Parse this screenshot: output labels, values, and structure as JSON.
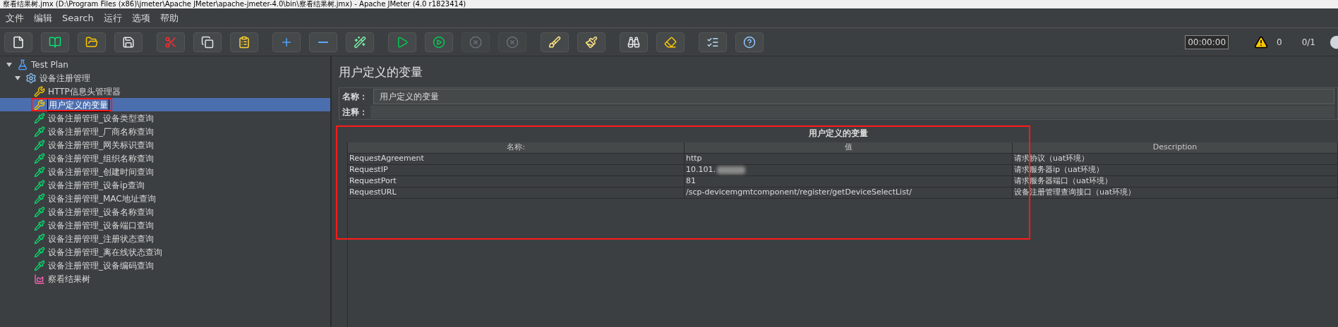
{
  "window": {
    "title": "察看结果树.jmx (D:\\Program Files (x86)\\jmeter\\Apache JMeter\\apache-jmeter-4.0\\bin\\察看结果树.jmx) - Apache JMeter (4.0 r1823414)"
  },
  "menu": [
    {
      "label": "文件"
    },
    {
      "label": "编辑"
    },
    {
      "label": "Search"
    },
    {
      "label": "运行"
    },
    {
      "label": "选项"
    },
    {
      "label": "帮助"
    }
  ],
  "toolbar": [
    [
      {
        "kind": "new",
        "disabled": false
      },
      {
        "kind": "templates",
        "disabled": false
      },
      {
        "kind": "open",
        "disabled": false
      },
      {
        "kind": "save",
        "disabled": false
      }
    ],
    [
      {
        "kind": "cut",
        "disabled": false
      },
      {
        "kind": "copy",
        "disabled": false
      },
      {
        "kind": "paste",
        "disabled": false
      }
    ],
    [
      {
        "kind": "add",
        "disabled": false
      },
      {
        "kind": "remove",
        "disabled": false
      },
      {
        "kind": "toggle",
        "disabled": false
      }
    ],
    [
      {
        "kind": "start",
        "disabled": false
      },
      {
        "kind": "start_no_pause",
        "disabled": false
      },
      {
        "kind": "stop",
        "disabled": true
      },
      {
        "kind": "shutdown",
        "disabled": true
      }
    ],
    [
      {
        "kind": "clear",
        "disabled": false
      },
      {
        "kind": "clear_all",
        "disabled": false
      }
    ],
    [
      {
        "kind": "search",
        "disabled": false
      },
      {
        "kind": "reset_search",
        "disabled": false
      }
    ],
    [
      {
        "kind": "functions",
        "disabled": false
      },
      {
        "kind": "help",
        "disabled": false
      }
    ]
  ],
  "status": {
    "timer": "00:00:00",
    "warnings": "0",
    "threads": "0/1"
  },
  "tree": [
    {
      "label": "Test Plan",
      "kind": "plan",
      "expanded": true,
      "selected": false,
      "children": [
        {
          "label": "设备注册管理",
          "kind": "thread_group",
          "expanded": true,
          "selected": false,
          "children": [
            {
              "label": "HTTP信息头管理器",
              "kind": "config",
              "selected": false
            },
            {
              "label": "用户定义的变量",
              "kind": "config",
              "selected": true,
              "highlighted": true
            },
            {
              "label": "设备注册管理_设备类型查询",
              "kind": "sampler",
              "selected": false
            },
            {
              "label": "设备注册管理_厂商名称查询",
              "kind": "sampler",
              "selected": false
            },
            {
              "label": "设备注册管理_网关标识查询",
              "kind": "sampler",
              "selected": false
            },
            {
              "label": "设备注册管理_组织名称查询",
              "kind": "sampler",
              "selected": false
            },
            {
              "label": "设备注册管理_创建时间查询",
              "kind": "sampler",
              "selected": false
            },
            {
              "label": "设备注册管理_设备ip查询",
              "kind": "sampler",
              "selected": false
            },
            {
              "label": "设备注册管理_MAC地址查询",
              "kind": "sampler",
              "selected": false
            },
            {
              "label": "设备注册管理_设备名称查询",
              "kind": "sampler",
              "selected": false
            },
            {
              "label": "设备注册管理_设备端口查询",
              "kind": "sampler",
              "selected": false
            },
            {
              "label": "设备注册管理_注册状态查询",
              "kind": "sampler",
              "selected": false
            },
            {
              "label": "设备注册管理_离在线状态查询",
              "kind": "sampler",
              "selected": false
            },
            {
              "label": "设备注册管理_设备编码查询",
              "kind": "sampler",
              "selected": false
            },
            {
              "label": "察看结果树",
              "kind": "listener",
              "selected": false
            }
          ]
        }
      ]
    }
  ],
  "panel": {
    "title": "用户定义的变量",
    "name_label": "名称：",
    "name_value": "用户定义的变量",
    "comment_label": "注释：",
    "table": {
      "title": "用户定义的变量",
      "highlighted": true,
      "columns": [
        "名称:",
        "值",
        "Description"
      ],
      "rows": [
        {
          "cells": [
            "RequestAgreement",
            "http",
            "请求协议（uat环境）"
          ]
        },
        {
          "cells": [
            "RequestIP",
            "10.101.",
            "请求服务器ip（uat环境）"
          ],
          "redacted": true
        },
        {
          "cells": [
            "RequestPort",
            "81",
            "请求服务器端口（uat环境）"
          ]
        },
        {
          "cells": [
            "RequestURL",
            "/scp-devicemgmtcomponent/register/getDeviceSelectList/",
            "设备注册管理查询接口（uat环境）"
          ]
        }
      ]
    }
  }
}
